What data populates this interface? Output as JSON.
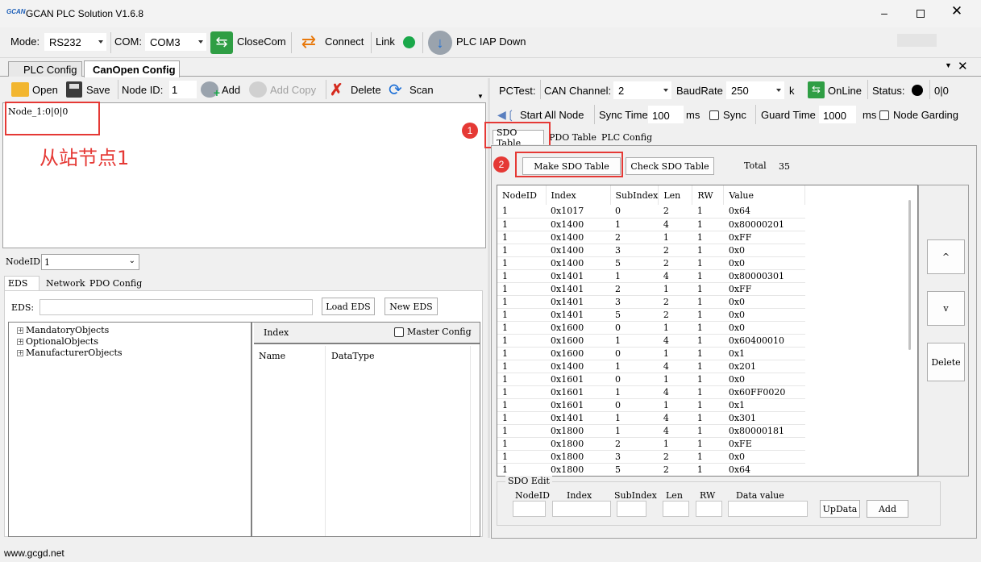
{
  "window": {
    "title": "GCAN PLC Solution V1.6.8",
    "logo": "GCAN"
  },
  "toolbar": {
    "mode_label": "Mode:",
    "mode_value": "RS232",
    "com_label": "COM:",
    "com_value": "COM3",
    "close_com": "CloseCom",
    "connect": "Connect",
    "link": "Link",
    "link_color": "#1aa84a",
    "plc_iap": "PLC IAP Down"
  },
  "tabs": {
    "plc_config": "PLC Config",
    "canopen_config": "CanOpen Config"
  },
  "left_toolbar": {
    "open": "Open",
    "save": "Save",
    "node_id_label": "Node ID:",
    "node_id_value": "1",
    "add": "Add",
    "add_copy": "Add Copy",
    "delete": "Delete",
    "scan": "Scan"
  },
  "node_list": {
    "item": "Node_1:0|0|0",
    "annotation": "从站节点1"
  },
  "eds_section": {
    "node_id_label": "NodeID",
    "node_id_value": "1",
    "tabs": [
      "EDS",
      "Network",
      "PDO Config"
    ],
    "eds_label": "EDS:",
    "load_eds": "Load EDS",
    "new_eds": "New EDS",
    "tree": [
      "MandatoryObjects",
      "OptionalObjects",
      "ManufacturerObjects"
    ],
    "index_label": "Index",
    "master_config": "Master Config",
    "col_name": "Name",
    "col_datatype": "DataType"
  },
  "pctest": {
    "label": "PCTest:",
    "can_channel_label": "CAN Channel:",
    "can_channel_value": "2",
    "baud_label": "BaudRate",
    "baud_value": "250",
    "baud_unit": "k",
    "online": "OnLine",
    "status_label": "Status:",
    "status_value": "0|0",
    "start_all": "Start All Node",
    "sync_time_label": "Sync Time",
    "sync_time_value": "100",
    "ms": "ms",
    "sync": "Sync",
    "guard_time_label": "Guard Time",
    "guard_time_value": "1000",
    "node_garding": "Node Garding"
  },
  "sdo_tabs": [
    "SDO Table",
    "PDO Table",
    "PLC Config"
  ],
  "sdo": {
    "make": "Make SDO Table",
    "check": "Check SDO Table",
    "total_label": "Total",
    "total_value": "35",
    "columns": [
      "NodeID",
      "Index",
      "SubIndex",
      "Len",
      "RW",
      "Value"
    ],
    "rows": [
      [
        "1",
        "0x1017",
        "0",
        "2",
        "1",
        "0x64"
      ],
      [
        "1",
        "0x1400",
        "1",
        "4",
        "1",
        "0x80000201"
      ],
      [
        "1",
        "0x1400",
        "2",
        "1",
        "1",
        "0xFF"
      ],
      [
        "1",
        "0x1400",
        "3",
        "2",
        "1",
        "0x0"
      ],
      [
        "1",
        "0x1400",
        "5",
        "2",
        "1",
        "0x0"
      ],
      [
        "1",
        "0x1401",
        "1",
        "4",
        "1",
        "0x80000301"
      ],
      [
        "1",
        "0x1401",
        "2",
        "1",
        "1",
        "0xFF"
      ],
      [
        "1",
        "0x1401",
        "3",
        "2",
        "1",
        "0x0"
      ],
      [
        "1",
        "0x1401",
        "5",
        "2",
        "1",
        "0x0"
      ],
      [
        "1",
        "0x1600",
        "0",
        "1",
        "1",
        "0x0"
      ],
      [
        "1",
        "0x1600",
        "1",
        "4",
        "1",
        "0x60400010"
      ],
      [
        "1",
        "0x1600",
        "0",
        "1",
        "1",
        "0x1"
      ],
      [
        "1",
        "0x1400",
        "1",
        "4",
        "1",
        "0x201"
      ],
      [
        "1",
        "0x1601",
        "0",
        "1",
        "1",
        "0x0"
      ],
      [
        "1",
        "0x1601",
        "1",
        "4",
        "1",
        "0x60FF0020"
      ],
      [
        "1",
        "0x1601",
        "0",
        "1",
        "1",
        "0x1"
      ],
      [
        "1",
        "0x1401",
        "1",
        "4",
        "1",
        "0x301"
      ],
      [
        "1",
        "0x1800",
        "1",
        "4",
        "1",
        "0x80000181"
      ],
      [
        "1",
        "0x1800",
        "2",
        "1",
        "1",
        "0xFE"
      ],
      [
        "1",
        "0x1800",
        "3",
        "2",
        "1",
        "0x0"
      ],
      [
        "1",
        "0x1800",
        "5",
        "2",
        "1",
        "0x64"
      ]
    ],
    "side": {
      "up": "^",
      "down": "v",
      "delete": "Delete"
    },
    "edit": {
      "title": "SDO Edit",
      "labels": [
        "NodeID",
        "Index",
        "SubIndex",
        "Len",
        "RW",
        "Data value"
      ],
      "update": "UpData",
      "add": "Add"
    }
  },
  "markers": {
    "one": "1",
    "two": "2"
  },
  "statusbar": {
    "text": "www.gcgd.net"
  }
}
